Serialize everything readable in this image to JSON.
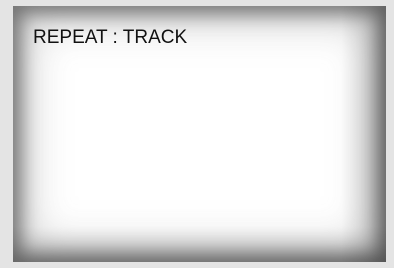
{
  "osd": {
    "repeat_label": "REPEAT : TRACK"
  }
}
